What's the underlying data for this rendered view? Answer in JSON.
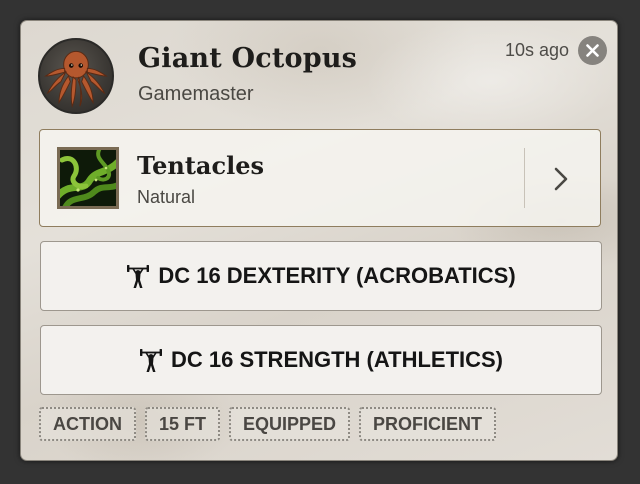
{
  "message": {
    "actor_name": "Giant Octopus",
    "actor_role": "Gamemaster",
    "timestamp": "10s ago",
    "close_icon": "close-icon"
  },
  "item": {
    "name": "Tentacles",
    "type": "Natural",
    "thumbnail_icon": "tentacles-icon",
    "expand_icon": "chevron-right-icon"
  },
  "checks": [
    {
      "label": "DC 16 DEXTERITY (ACROBATICS)",
      "icon": "weightlifter-icon"
    },
    {
      "label": "DC 16 STRENGTH (ATHLETICS)",
      "icon": "weightlifter-icon"
    }
  ],
  "tags": [
    "ACTION",
    "15 FT",
    "EQUIPPED",
    "PROFICIENT"
  ],
  "colors": {
    "panel_background": "#e1ddd6",
    "text_dark": "#1e1d1b",
    "item_border": "#8f7d5e",
    "close_button": "#86837e",
    "octopus": "#b5582e"
  }
}
